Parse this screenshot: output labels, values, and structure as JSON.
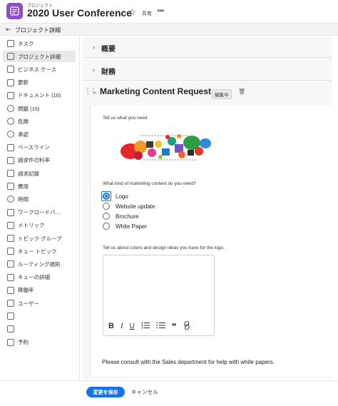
{
  "header": {
    "app_label": "プロジェクト",
    "title": "2020 User Conference",
    "share_label": "共有",
    "star_icon": "star-icon",
    "more_icon": "more-icon"
  },
  "subheader": {
    "title": "プロジェクト詳細"
  },
  "sidebar": {
    "items": [
      {
        "label": "タスク",
        "icon": "task-icon"
      },
      {
        "label": "プロジェクト詳細",
        "icon": "details-icon",
        "active": true
      },
      {
        "label": "ビジネス ケース",
        "icon": "business-case-icon"
      },
      {
        "label": "更新",
        "icon": "updates-icon"
      },
      {
        "label": "ドキュメント (16)",
        "icon": "document-icon"
      },
      {
        "label": "問題 (15)",
        "icon": "issues-icon"
      },
      {
        "label": "危険",
        "icon": "risk-icon"
      },
      {
        "label": "承認",
        "icon": "approval-icon"
      },
      {
        "label": "ベースライン",
        "icon": "baseline-icon"
      },
      {
        "label": "請求件の料率",
        "icon": "billing-rates-icon"
      },
      {
        "label": "請求記録",
        "icon": "billing-records-icon"
      },
      {
        "label": "費用",
        "icon": "expenses-icon"
      },
      {
        "label": "時間",
        "icon": "hours-icon"
      },
      {
        "label": "ワークロードバ…",
        "icon": "workload-icon"
      },
      {
        "label": "メトリック",
        "icon": "metrics-icon"
      },
      {
        "label": "トピック グループ",
        "icon": "topic-group-icon"
      },
      {
        "label": "キュー トピック",
        "icon": "queue-topic-icon"
      },
      {
        "label": "ルーティング規則",
        "icon": "routing-rules-icon"
      },
      {
        "label": "キューの詳細",
        "icon": "queue-details-icon"
      },
      {
        "label": "稼働率",
        "icon": "utilization-icon"
      },
      {
        "label": "ユーザー",
        "icon": "users-icon"
      },
      {
        "label": "",
        "icon": "generic-icon"
      },
      {
        "label": "",
        "icon": "generic-icon"
      },
      {
        "label": "予約",
        "icon": "reservation-icon"
      }
    ]
  },
  "sections": {
    "overview": "概要",
    "finance": "財務",
    "request_title": "Marketing Content Request",
    "edit_badge": "編集中"
  },
  "form": {
    "prompt1": "Tell us what you need",
    "question": "What kind of marketing content do you need?",
    "options": [
      "Logo",
      "Website update",
      "Brochure",
      "White Paper"
    ],
    "selected": "Logo",
    "prompt2": "Tell us about colors and design ideas you have for the logo.",
    "textarea_value": "",
    "toolbar": [
      "B",
      "I",
      "U",
      "ordered-list",
      "bullet-list",
      "quote",
      "link"
    ],
    "consult": "Please consult with the Sales department for help with white papers."
  },
  "footer": {
    "save_label": "変更を保存",
    "cancel_label": "キャンセル"
  },
  "colors": {
    "brand_purple": "#8d4fc4",
    "accent_blue": "#1473e6"
  }
}
